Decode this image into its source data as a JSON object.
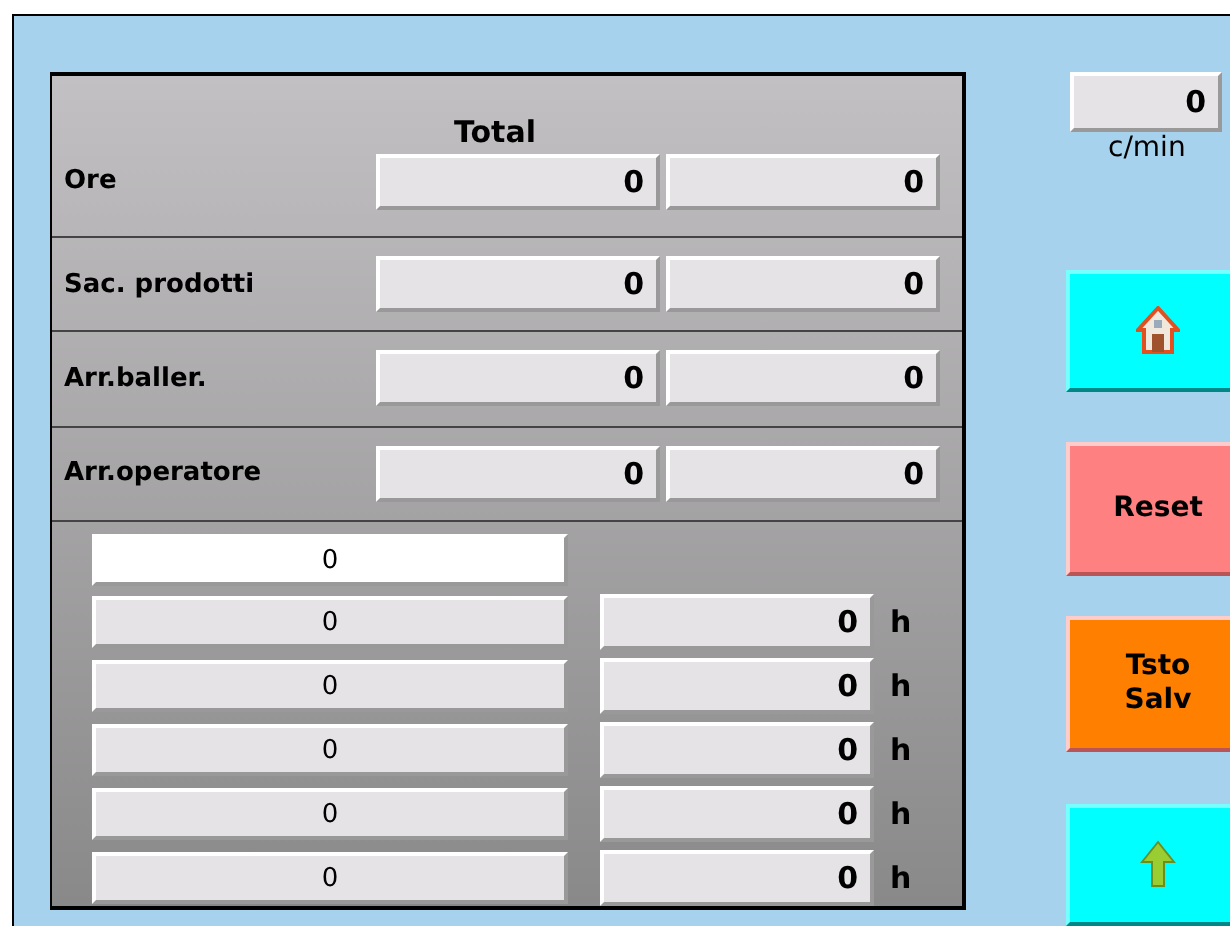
{
  "header": "Total",
  "rows": [
    {
      "label": "Ore",
      "values": [
        "0",
        "0"
      ]
    },
    {
      "label": "Sac. prodotti",
      "values": [
        "0",
        "0"
      ]
    },
    {
      "label": "Arr.baller.",
      "values": [
        "0",
        "0"
      ]
    },
    {
      "label": "Arr.operatore",
      "values": [
        "0",
        "0"
      ]
    }
  ],
  "top_field": {
    "value": "0",
    "selected": true
  },
  "counter_rows": [
    {
      "value": "0",
      "hours": "0",
      "unit": "h",
      "selected": false
    },
    {
      "value": "0",
      "hours": "0",
      "unit": "h",
      "selected": false
    },
    {
      "value": "0",
      "hours": "0",
      "unit": "h",
      "selected": false
    },
    {
      "value": "0",
      "hours": "0",
      "unit": "h",
      "selected": false
    },
    {
      "value": "0",
      "hours": "0",
      "unit": "h",
      "selected": false
    }
  ],
  "rate": {
    "value": "0",
    "unit": "c/min"
  },
  "buttons": [
    {
      "kind": "home"
    },
    {
      "kind": "text",
      "label": "Reset",
      "color": "#ff8080"
    },
    {
      "kind": "text",
      "label": "Tsto\nSalv",
      "color": "#ff8000"
    },
    {
      "kind": "up"
    }
  ]
}
